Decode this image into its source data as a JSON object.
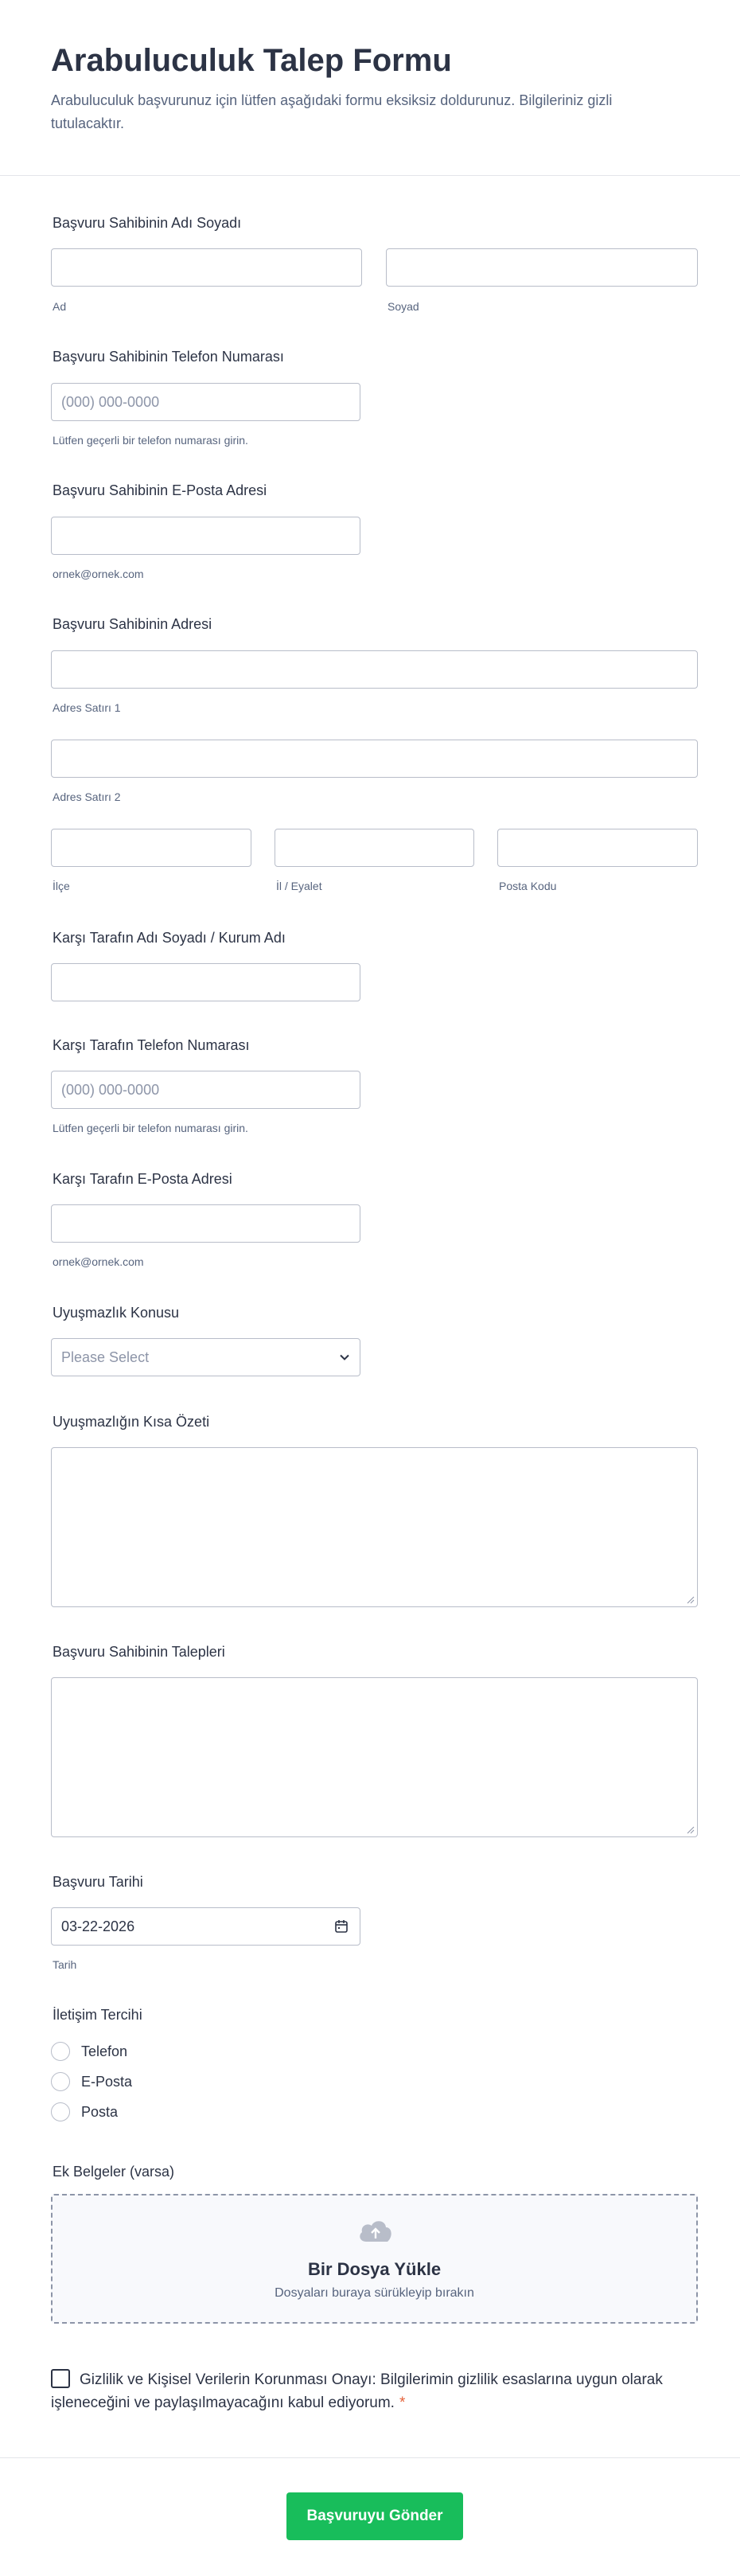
{
  "form": {
    "title": "Arabuluculuk Talep Formu",
    "subtitle": "Arabuluculuk başvurunuz için lütfen aşağıdaki formu eksiksiz doldurunuz. Bilgileriniz gizli tutulacaktır."
  },
  "fields": {
    "applicant_name": {
      "label": "Başvuru Sahibinin Adı Soyadı",
      "first_sub": "Ad",
      "last_sub": "Soyad"
    },
    "applicant_phone": {
      "label": "Başvuru Sahibinin Telefon Numarası",
      "placeholder": "(000) 000-0000",
      "hint": "Lütfen geçerli bir telefon numarası girin."
    },
    "applicant_email": {
      "label": "Başvuru Sahibinin E-Posta Adresi",
      "hint": "ornek@ornek.com"
    },
    "applicant_address": {
      "label": "Başvuru Sahibinin Adresi",
      "line1_sub": "Adres Satırı 1",
      "line2_sub": "Adres Satırı 2",
      "district_sub": "İlçe",
      "city_sub": "İl / Eyalet",
      "postal_sub": "Posta Kodu"
    },
    "counterparty_name": {
      "label": "Karşı Tarafın Adı Soyadı / Kurum Adı"
    },
    "counterparty_phone": {
      "label": "Karşı Tarafın Telefon Numarası",
      "placeholder": "(000) 000-0000",
      "hint": "Lütfen geçerli bir telefon numarası girin."
    },
    "counterparty_email": {
      "label": "Karşı Tarafın E-Posta Adresi",
      "hint": "ornek@ornek.com"
    },
    "dispute_subject": {
      "label": "Uyuşmazlık Konusu",
      "placeholder": "Please Select"
    },
    "dispute_summary": {
      "label": "Uyuşmazlığın Kısa Özeti"
    },
    "applicant_requests": {
      "label": "Başvuru Sahibinin Talepleri"
    },
    "application_date": {
      "label": "Başvuru Tarihi",
      "value": "03-22-2026",
      "sub": "Tarih"
    },
    "contact_preference": {
      "label": "İletişim Tercihi",
      "options": [
        "Telefon",
        "E-Posta",
        "Posta"
      ]
    },
    "attachments": {
      "label": "Ek Belgeler (varsa)",
      "upload_title": "Bir Dosya Yükle",
      "upload_sub": "Dosyaları buraya sürükleyip bırakın"
    },
    "consent": {
      "text": "Gizlilik ve Kişisel Verilerin Korunması Onayı: Bilgilerimin gizlilik esaslarına uygun olarak işleneceğini ve paylaşılmayacağını kabul ediyorum.",
      "required_mark": "*"
    }
  },
  "submit": {
    "label": "Başvuruyu Gönder"
  },
  "colors": {
    "submit_bg": "#18bd5b",
    "border": "#b8bdc9",
    "text": "#2c3345",
    "required": "#e5623a"
  },
  "icons": {
    "date": "calendar-icon",
    "dropdown": "chevron-down-icon",
    "upload": "cloud-upload-icon"
  }
}
